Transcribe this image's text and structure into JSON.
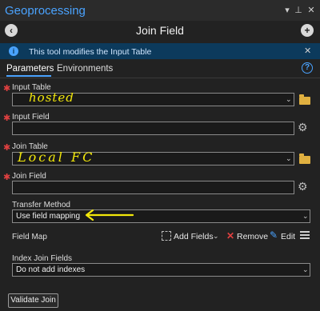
{
  "pane": {
    "title": "Geoprocessing"
  },
  "tool": {
    "title": "Join Field"
  },
  "banner": {
    "text": "This tool modifies the Input Table"
  },
  "tabs": [
    {
      "label": "Parameters",
      "active": true
    },
    {
      "label": "Environments",
      "active": false
    }
  ],
  "params": {
    "input_table": {
      "label": "Input Table",
      "value": "hosted",
      "required": true
    },
    "input_field": {
      "label": "Input Field",
      "value": "",
      "required": true
    },
    "join_table": {
      "label": "Join Table",
      "value": "Local FC",
      "required": true
    },
    "join_field": {
      "label": "Join Field",
      "value": "",
      "required": true
    },
    "transfer_method": {
      "label": "Transfer Method",
      "value": "Use field mapping"
    },
    "field_map": {
      "label": "Field Map",
      "add_fields": "Add Fields",
      "remove": "Remove",
      "edit": "Edit"
    },
    "index_join_fields": {
      "label": "Index Join Fields",
      "value": "Do not add indexes"
    }
  },
  "validate_button": "Validate Join",
  "icons": {
    "info": "info-icon",
    "back": "back-arrow-icon",
    "add": "plus-icon",
    "help": "help-icon",
    "folder": "folder-icon",
    "gear": "gear-icon"
  },
  "colors": {
    "accent": "#4aa3ff",
    "banner_bg": "#0c3a5c",
    "required": "#e04040",
    "annotation": "#f3e80a"
  }
}
